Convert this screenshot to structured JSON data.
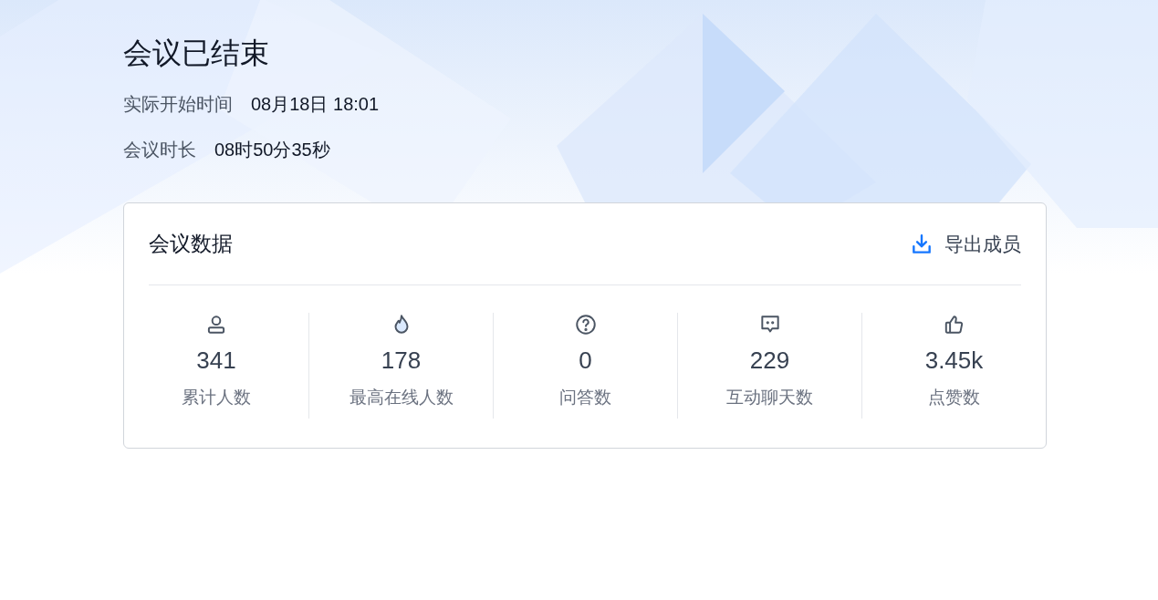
{
  "title": "会议已结束",
  "info": [
    {
      "label": "实际开始时间",
      "value": "08月18日 18:01"
    },
    {
      "label": "会议时长",
      "value": "08时50分35秒"
    }
  ],
  "card": {
    "title": "会议数据",
    "export_button": "导出成员",
    "stats": [
      {
        "kind": "person",
        "value": "341",
        "label": "累计人数"
      },
      {
        "kind": "flame",
        "value": "178",
        "label": "最高在线人数"
      },
      {
        "kind": "question",
        "value": "0",
        "label": "问答数"
      },
      {
        "kind": "chat",
        "value": "229",
        "label": "互动聊天数"
      },
      {
        "kind": "thumb",
        "value": "3.45k",
        "label": "点赞数"
      }
    ]
  }
}
